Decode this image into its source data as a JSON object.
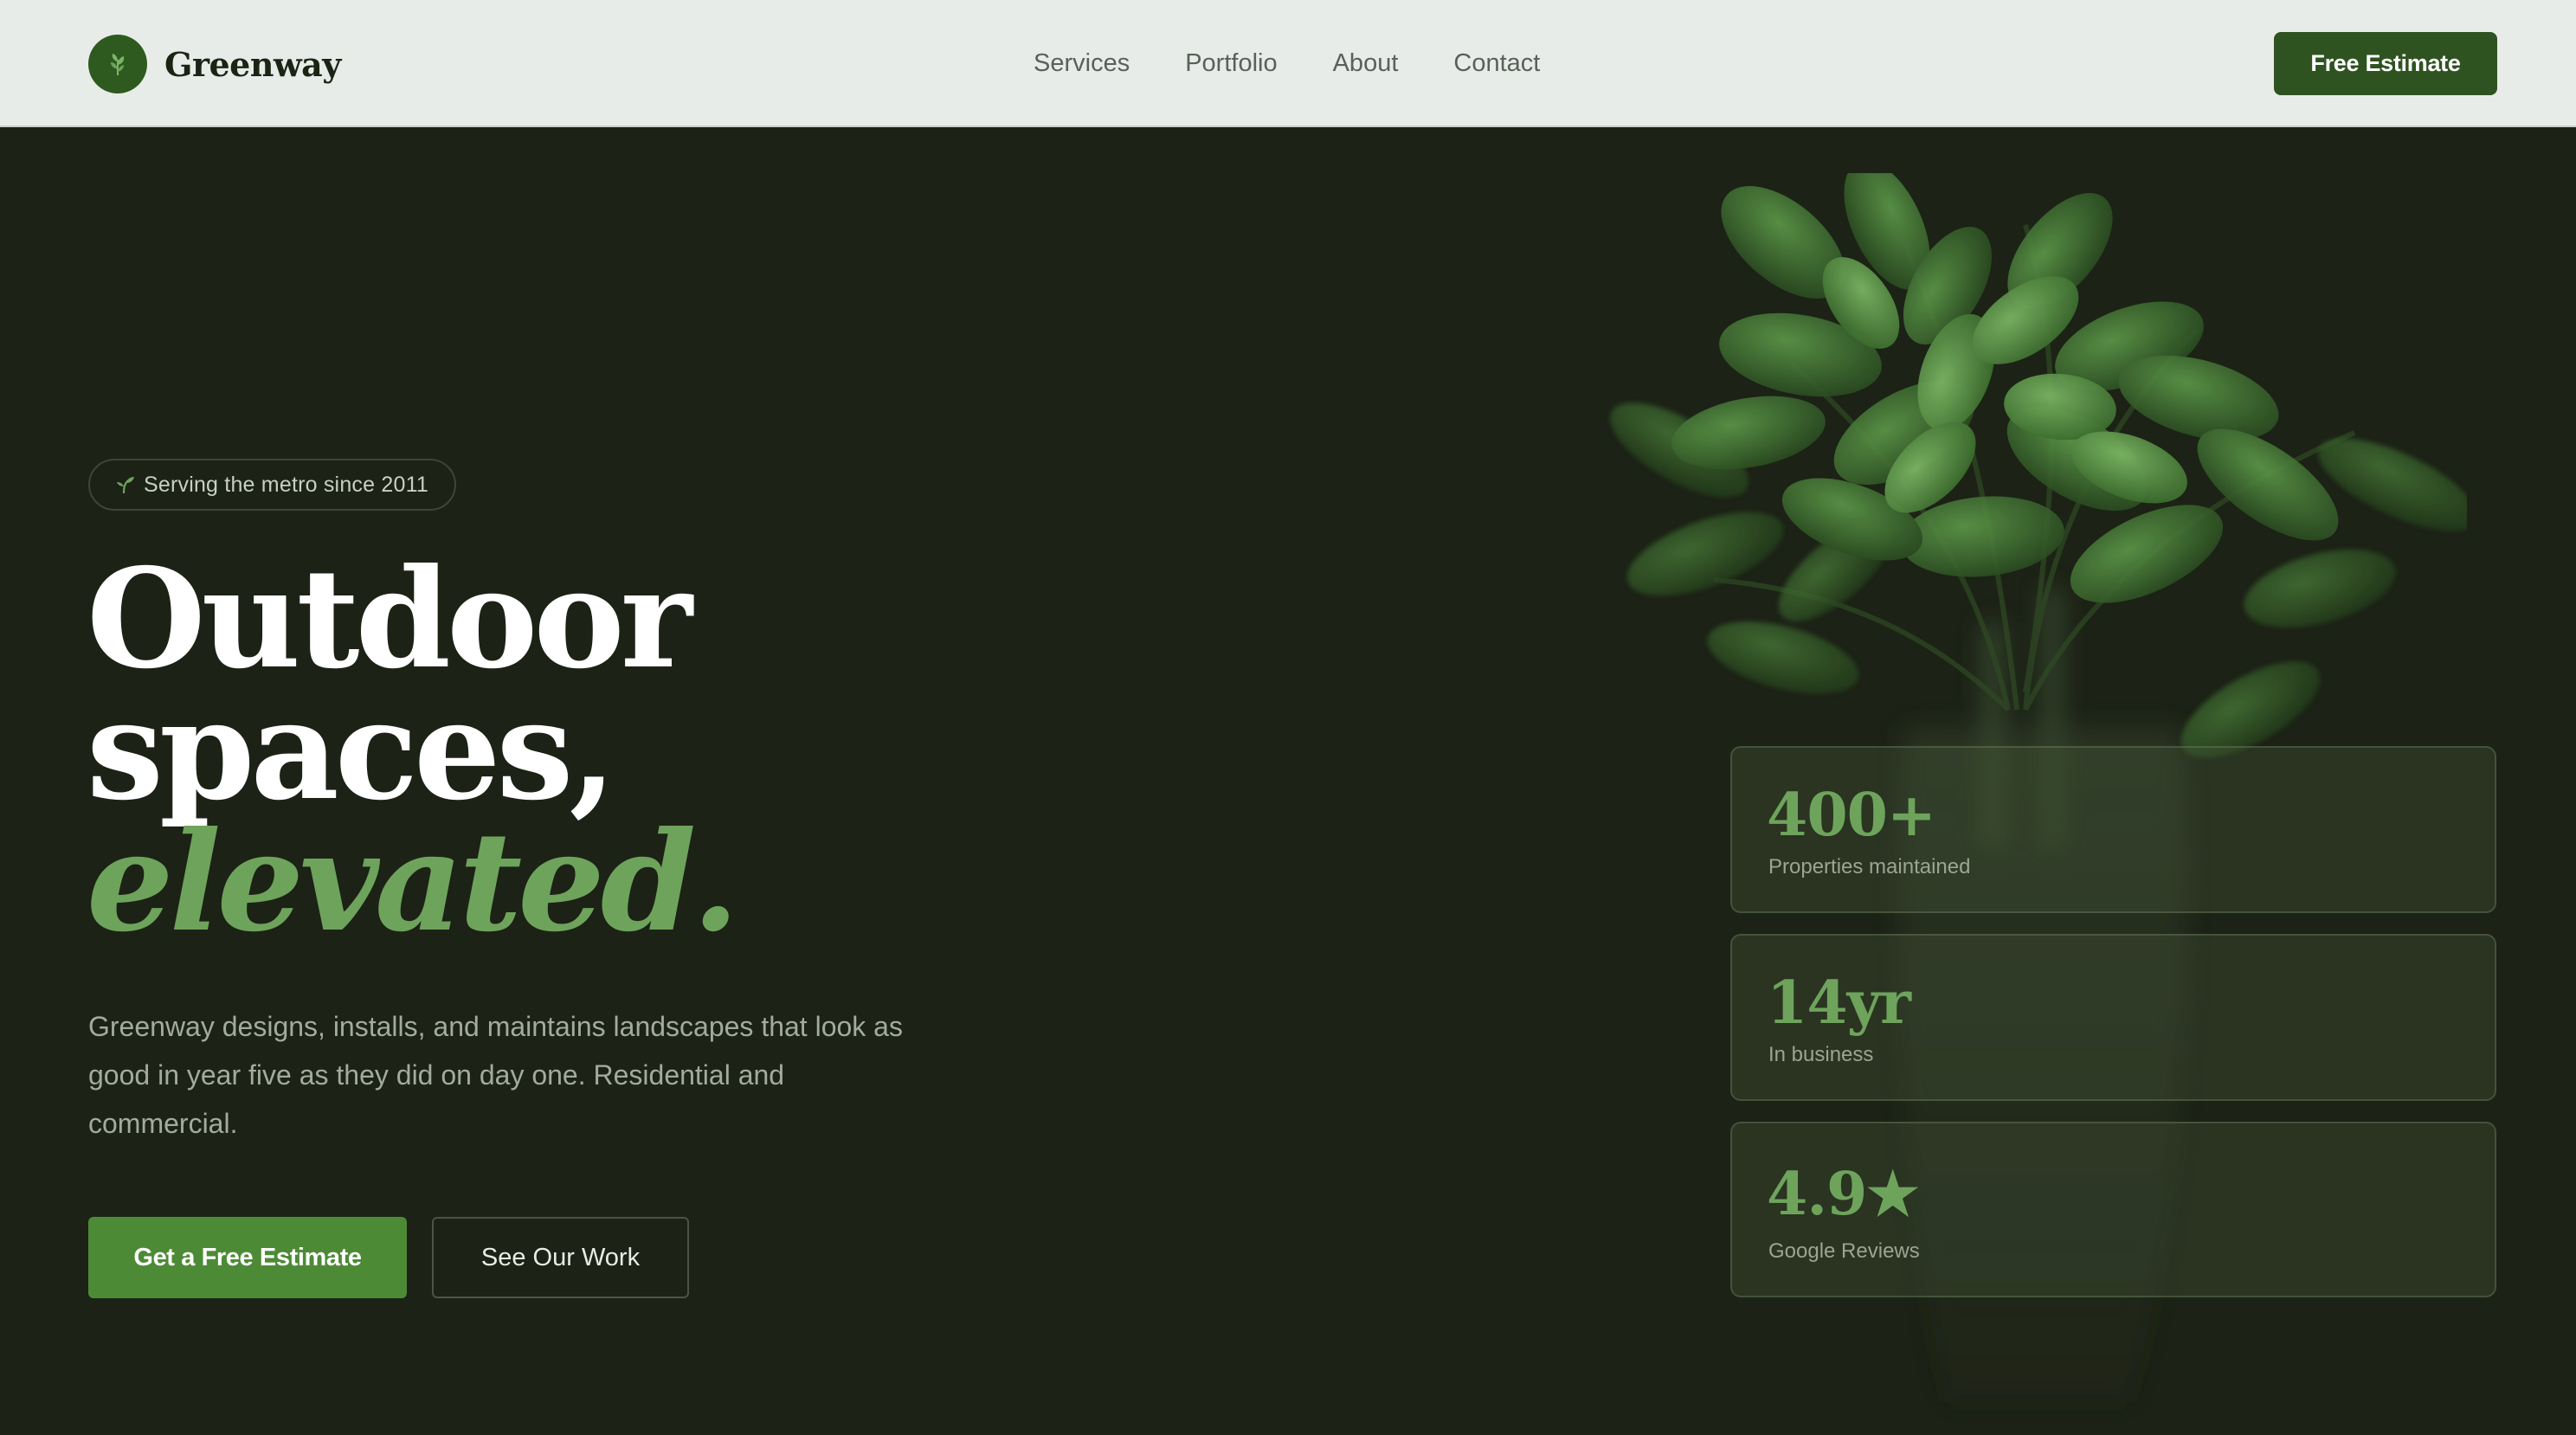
{
  "brand": {
    "name": "Greenway",
    "logo_icon": "leaf-sprig-icon",
    "accent_color": "#2e5a1f"
  },
  "nav": {
    "links": [
      "Services",
      "Portfolio",
      "About",
      "Contact"
    ],
    "cta_label": "Free Estimate"
  },
  "hero": {
    "badge_icon": "sprout-icon",
    "badge_text": "Serving the metro since 2011",
    "headline_line1": "Outdoor",
    "headline_line2": "spaces,",
    "headline_accent": "elevated.",
    "lede": "Greenway designs, installs, and maintains landscapes that look as good in year five as they did on day one. Residential and commercial.",
    "primary_cta": "Get a Free Estimate",
    "secondary_cta": "See Our Work",
    "decor_image": "potted-plant"
  },
  "stats": [
    {
      "value": "400+",
      "label": "Properties maintained"
    },
    {
      "value": "14yr",
      "label": "In business"
    },
    {
      "value": "4.9★",
      "label": "Google Reviews"
    }
  ],
  "colors": {
    "background": "#1c2216",
    "nav_background": "#e8ece8",
    "accent_green": "#6ea35c",
    "primary_button": "#4d8a36",
    "nav_button": "#2e5320"
  }
}
